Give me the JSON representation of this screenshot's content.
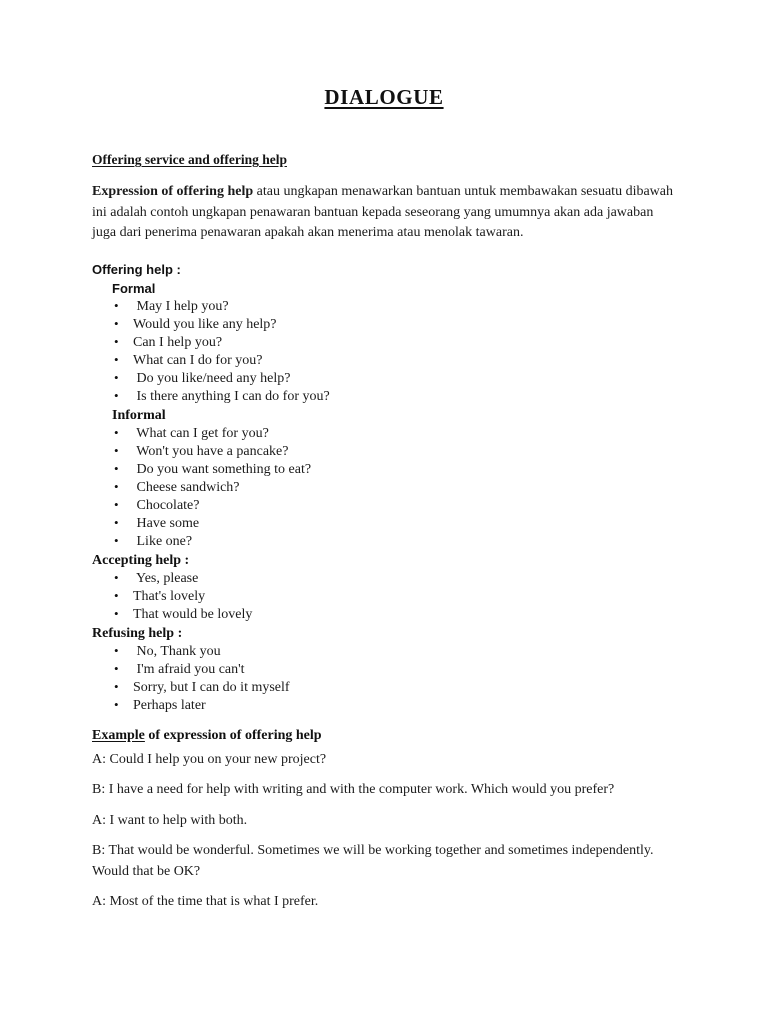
{
  "document": {
    "title": "DIALOGUE",
    "section_heading": "Offering service and offering help",
    "intro": {
      "bold_lead": "Expression of offering help",
      "rest": " atau ungkapan menawarkan bantuan untuk membawakan sesuatu dibawah ini adalah contoh ungkapan penawaran bantuan kepada seseorang yang umumnya akan ada jawaban juga dari penerima penawaran apakah akan menerima atau menolak tawaran."
    },
    "offering_help": {
      "heading": "Offering help :",
      "formal": {
        "label": "Formal",
        "items": [
          " May I help you?",
          "Would you like any help?",
          "Can I help you?",
          "What can I do for you?",
          " Do you like/need any help?",
          " Is there anything I can do for you?"
        ]
      },
      "informal": {
        "label": "Informal",
        "items": [
          " What can I get for you?",
          " Won't you have a pancake?",
          " Do you want something to eat?",
          " Cheese sandwich?",
          " Chocolate?",
          " Have some",
          " Like one?"
        ]
      }
    },
    "accepting_help": {
      "heading": "Accepting help :",
      "items": [
        " Yes, please",
        "That's lovely",
        "That would be lovely"
      ]
    },
    "refusing_help": {
      "heading": "Refusing help :",
      "items": [
        " No, Thank you",
        " I'm afraid you can't",
        "Sorry, but I can do it myself",
        "Perhaps later"
      ]
    },
    "example": {
      "heading_underlined": "Example",
      "heading_rest": " of expression of offering help",
      "lines": [
        "A: Could I help you on your new project?",
        "B: I have a need for help with writing and with the computer work. Which would you prefer?",
        "A: I want to help with both.",
        "B: That would be wonderful. Sometimes we will be working together and sometimes independently. Would that be OK?",
        "A: Most of the time that is what I prefer."
      ]
    }
  }
}
